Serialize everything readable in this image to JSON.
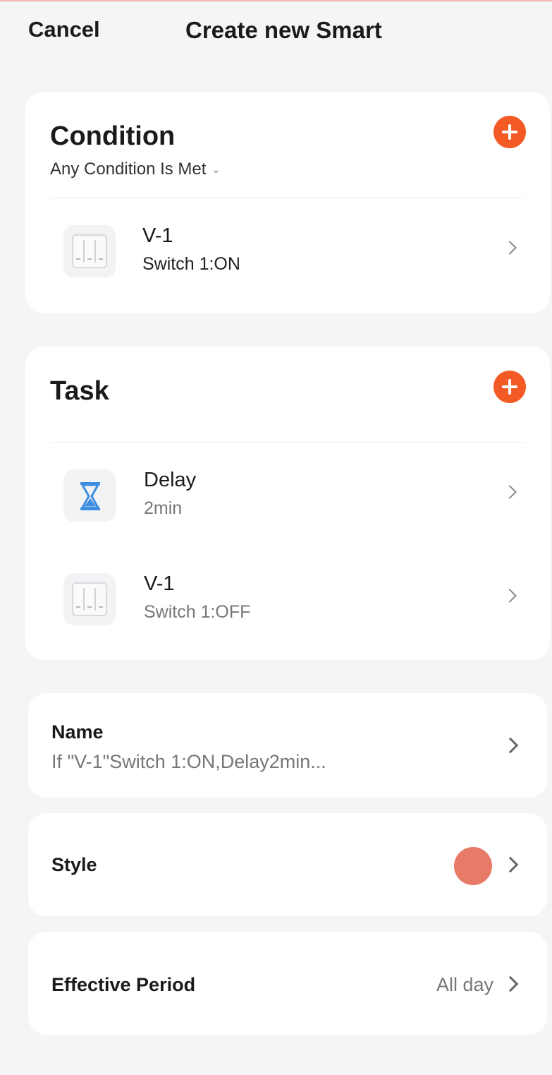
{
  "header": {
    "cancel_label": "Cancel",
    "title": "Create new Smart"
  },
  "condition": {
    "title": "Condition",
    "mode": "Any Condition Is Met",
    "items": [
      {
        "name": "V-1",
        "detail": "Switch 1:ON",
        "icon": "switch-panel-icon"
      }
    ]
  },
  "task": {
    "title": "Task",
    "items": [
      {
        "name": "Delay",
        "detail": "2min",
        "icon": "hourglass-icon"
      },
      {
        "name": "V-1",
        "detail": "Switch 1:OFF",
        "icon": "switch-panel-icon"
      }
    ]
  },
  "settings": {
    "name_label": "Name",
    "name_value": "If \"V-1\"Switch 1:ON,Delay2min...",
    "style_label": "Style",
    "style_color": "#e87a68",
    "period_label": "Effective Period",
    "period_value": "All day"
  },
  "colors": {
    "accent": "#f35a26",
    "delay_icon": "#3d8ee0"
  }
}
